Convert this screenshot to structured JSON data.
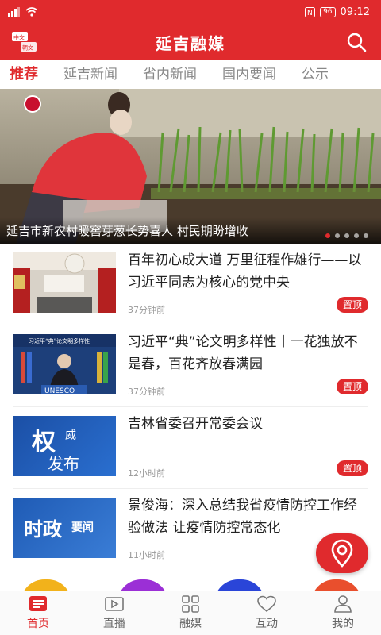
{
  "status_bar": {
    "battery": "96",
    "time": "09:12"
  },
  "header": {
    "title": "延吉融媒",
    "logo_text_top": "中文",
    "logo_text_bottom": "朝文"
  },
  "tabs": [
    {
      "label": "推荐",
      "active": true
    },
    {
      "label": "延吉新闻"
    },
    {
      "label": "省内新闻"
    },
    {
      "label": "国内要闻"
    },
    {
      "label": "公示"
    }
  ],
  "banner": {
    "caption": "延吉市新农村暖窖芽葱长势喜人  村民期盼增收",
    "slide_count": 5,
    "active_slide": 1
  },
  "news": [
    {
      "title": "百年初心成大道    万里征程作雄行——以习近平同志为核心的党中央",
      "time": "37分钟前",
      "pin": "置顶",
      "thumb": "photo"
    },
    {
      "title": "习近平“典”论文明多样性丨一花独放不是春，百花齐放春满园",
      "time": "37分钟前",
      "pin": "置顶",
      "thumb": "photo",
      "thumb_banner_text": "习近平“典”论文明多样性",
      "thumb_sign": "UNESCO"
    },
    {
      "title": "吉林省委召开常委会议",
      "time": "12小时前",
      "pin": "置顶",
      "thumb": "quanwei",
      "thumb_text": [
        "权",
        "威",
        "发布"
      ]
    },
    {
      "title": "景俊海：深入总结我省疫情防控工作经验做法 让疫情防控常态化",
      "time": "11小时前",
      "pin": "",
      "thumb": "shizheng",
      "thumb_text": [
        "时政",
        "要闻"
      ]
    }
  ],
  "bottom_nav": [
    {
      "label": "首页",
      "icon": "news-icon",
      "active": true
    },
    {
      "label": "直播",
      "icon": "live-video-icon"
    },
    {
      "label": "融媒",
      "icon": "grid-icon"
    },
    {
      "label": "互动",
      "icon": "heart-icon"
    },
    {
      "label": "我的",
      "icon": "person-icon"
    }
  ],
  "colors": {
    "brand": "#e02a2d",
    "peek_circles": [
      "#f2b21b",
      "#9b2fd6",
      "#2a45d8",
      "#e94f2d"
    ]
  }
}
